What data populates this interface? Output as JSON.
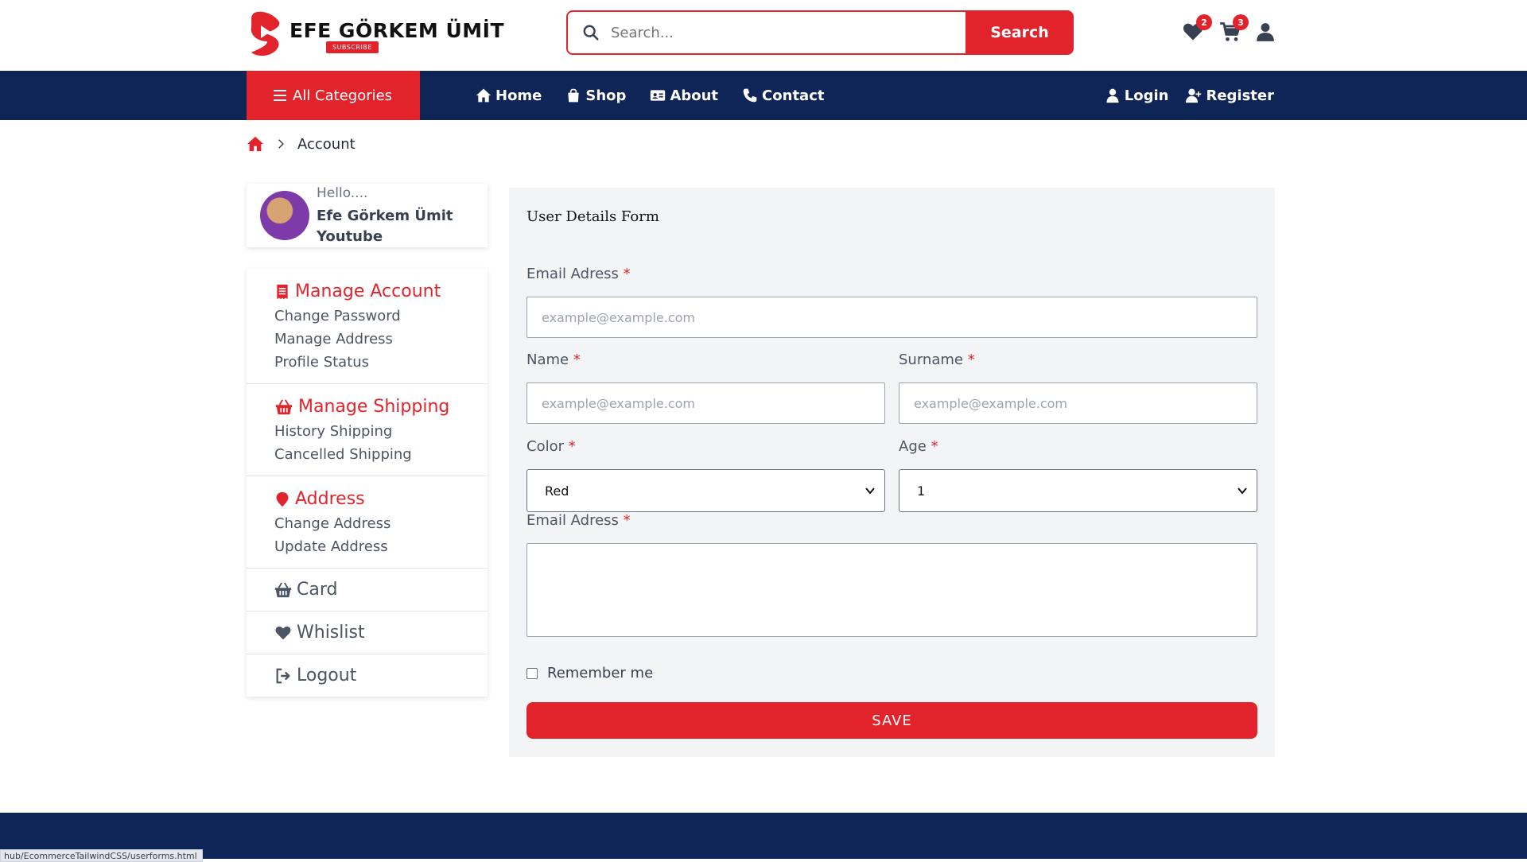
{
  "header": {
    "logo_text": "EFE GÖRKEM ÜMİT",
    "logo_sub": "SUBSCRIBE",
    "search_placeholder": "Search...",
    "search_button": "Search",
    "wishlist_count": "2",
    "cart_count": "3"
  },
  "nav": {
    "all_categories": "All Categories",
    "links": [
      "Home",
      "Shop",
      "About",
      "Contact"
    ],
    "login": "Login",
    "register": "Register"
  },
  "breadcrumb": {
    "current": "Account"
  },
  "profile": {
    "greeting": "Hello....",
    "name": "Efe Görkem Ümit Youtube"
  },
  "sidebar": {
    "sections": [
      {
        "title": "Manage Account",
        "icon": "receipt-icon",
        "items": [
          "Change Password",
          "Manage Address",
          "Profile Status"
        ]
      },
      {
        "title": "Manage Shipping",
        "icon": "basket-icon",
        "items": [
          "History Shipping",
          "Cancelled Shipping"
        ]
      },
      {
        "title": "Address",
        "icon": "map-pin-icon",
        "items": [
          "Change Address",
          "Update Address"
        ]
      }
    ],
    "plain": [
      {
        "label": "Card",
        "icon": "basket-icon"
      },
      {
        "label": "Whislist",
        "icon": "heart-icon"
      },
      {
        "label": "Logout",
        "icon": "logout-icon"
      }
    ]
  },
  "form": {
    "title": "User Details Form",
    "email_label": "Email Adress",
    "email_placeholder": "example@example.com",
    "name_label": "Name",
    "name_placeholder": "example@example.com",
    "surname_label": "Surname",
    "surname_placeholder": "example@example.com",
    "color_label": "Color",
    "color_value": "Red",
    "age_label": "Age",
    "age_value": "1",
    "message_label": "Email Adress",
    "required_mark": "*",
    "remember": "Remember me",
    "save": "SAVE"
  },
  "status_url": "hub/EcommerceTailwindCSS/userforms.html",
  "colors": {
    "brand_red": "#e3232b",
    "navy": "#0f2557",
    "panel": "#f3f4f6"
  }
}
